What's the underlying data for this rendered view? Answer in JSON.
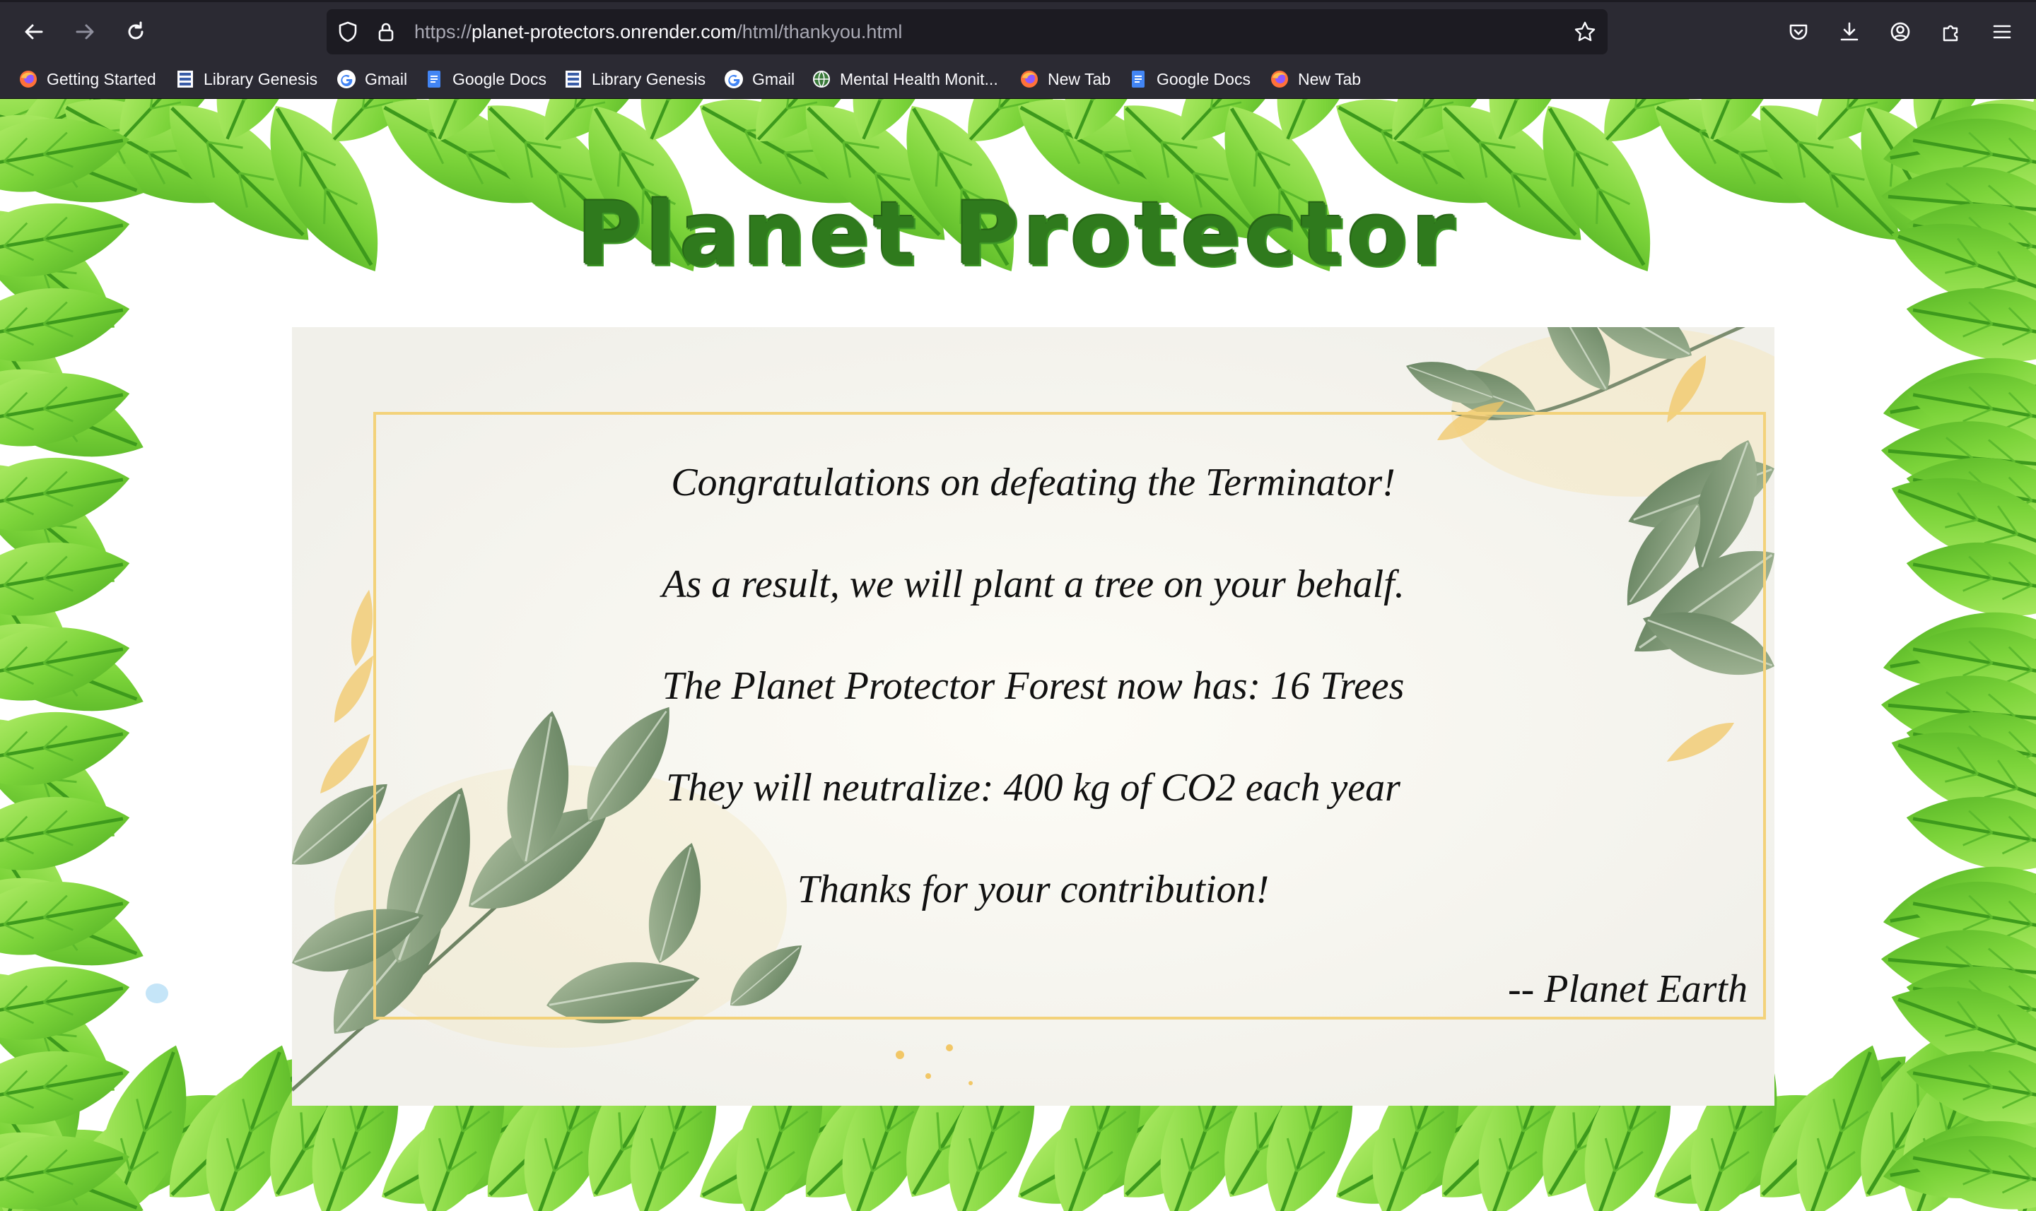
{
  "browser": {
    "url_full": "https://planet-protectors.onrender.com/html/thankyou.html",
    "url_scheme": "https://",
    "url_host": "planet-protectors.onrender.com",
    "url_path": "/html/thankyou.html",
    "bookmarks": [
      {
        "label": "Getting Started",
        "icon": "firefox-icon"
      },
      {
        "label": "Library Genesis",
        "icon": "library-genesis-icon"
      },
      {
        "label": "Gmail",
        "icon": "google-icon"
      },
      {
        "label": "Google Docs",
        "icon": "google-docs-icon"
      },
      {
        "label": "Library Genesis",
        "icon": "library-genesis-icon"
      },
      {
        "label": "Gmail",
        "icon": "google-icon"
      },
      {
        "label": "Mental Health Monit...",
        "icon": "globe-icon"
      },
      {
        "label": "New Tab",
        "icon": "firefox-icon"
      },
      {
        "label": "Google Docs",
        "icon": "google-docs-icon"
      },
      {
        "label": "New Tab",
        "icon": "firefox-icon"
      }
    ]
  },
  "page": {
    "title": "Planet Protector",
    "messages": [
      "Congratulations on defeating the Terminator!",
      "As a result, we will plant a tree on your behalf.",
      "The Planet Protector Forest now has: 16 Trees",
      "They will neutralize: 400 kg of CO2 each year",
      "Thanks for your contribution!"
    ],
    "signature": "-- Planet Earth"
  },
  "colors": {
    "toolbar": "#2b2a33",
    "urlbar": "#1c1b22",
    "title_green": "#2f7a1d",
    "leaf_green": "#7cd43a",
    "card_border": "#f3d27a"
  }
}
